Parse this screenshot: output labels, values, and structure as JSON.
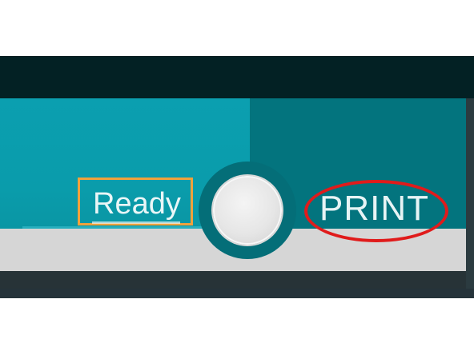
{
  "control_bar": {
    "status_label": "Ready",
    "print_label": "PRINT"
  },
  "colors": {
    "top_bar": "#032124",
    "left_panel": "#0b9fb0",
    "right_panel": "#03747e",
    "light_band": "#d6d6d6",
    "status_highlight": "#f0a23c",
    "print_highlight": "#e01b1b",
    "label_text": "#e9f6f7"
  },
  "icons": {
    "dial": "round-toggle-knob"
  }
}
